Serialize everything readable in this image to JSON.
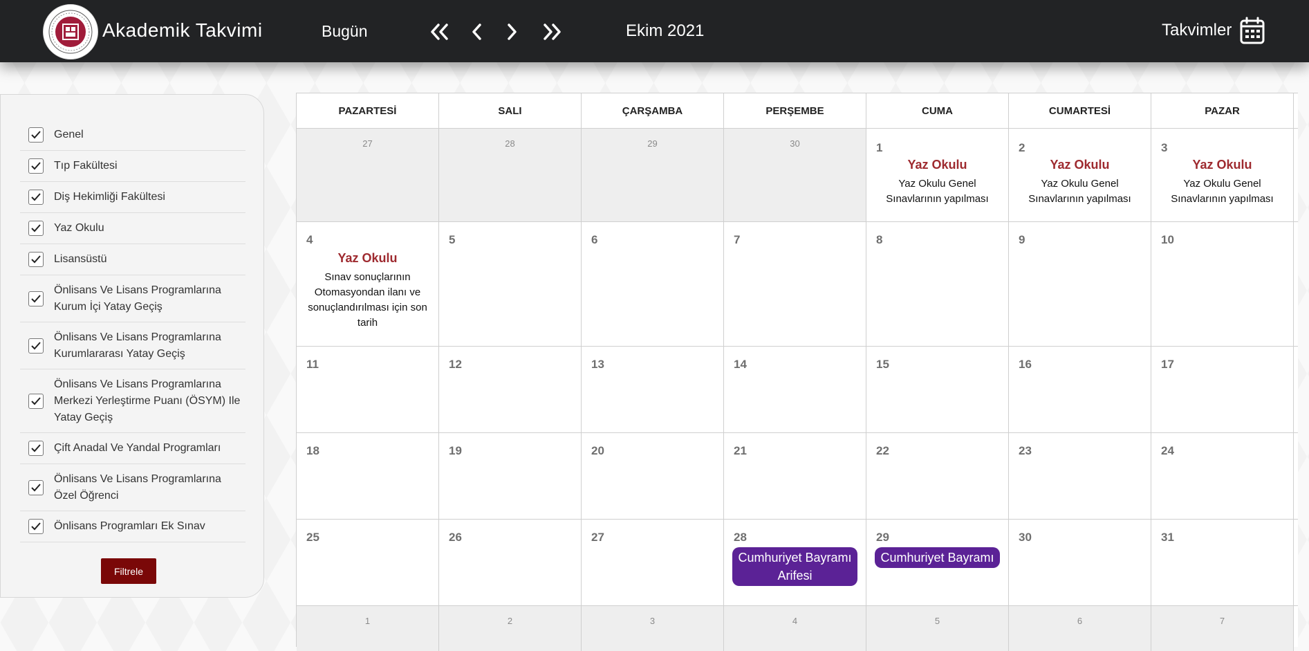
{
  "header": {
    "title": "Akademik Takvimi",
    "today_label": "Bugün",
    "month_label": "Ekim 2021",
    "calendars_label": "Takvimler"
  },
  "filters": {
    "items": [
      {
        "label": "Genel",
        "checked": true
      },
      {
        "label": "Tıp Fakültesi",
        "checked": true
      },
      {
        "label": "Diş Hekimliği Fakültesi",
        "checked": true
      },
      {
        "label": "Yaz Okulu",
        "checked": true
      },
      {
        "label": "Lisansüstü",
        "checked": true
      },
      {
        "label": "Önlisans Ve Lisans Programlarına Kurum İçi Yatay Geçiş",
        "checked": true
      },
      {
        "label": "Önlisans Ve Lisans Programlarına Kurumlararası Yatay Geçiş",
        "checked": true
      },
      {
        "label": "Önlisans Ve Lisans Programlarına Merkezi Yerleştirme Puanı (ÖSYM) Ile Yatay Geçiş",
        "checked": true
      },
      {
        "label": "Çift Anadal Ve Yandal Programları",
        "checked": true
      },
      {
        "label": "Önlisans Ve Lisans Programlarına Özel Öğrenci",
        "checked": true
      },
      {
        "label": "Önlisans Programları Ek Sınav",
        "checked": true
      }
    ],
    "button_label": "Filtrele"
  },
  "calendar": {
    "days": [
      "PAZARTESİ",
      "SALI",
      "ÇARŞAMBA",
      "PERŞEMBE",
      "CUMA",
      "CUMARTESİ",
      "PAZAR"
    ],
    "weeks": [
      [
        {
          "n": "27",
          "out": true
        },
        {
          "n": "28",
          "out": true
        },
        {
          "n": "29",
          "out": true
        },
        {
          "n": "30",
          "out": true
        },
        {
          "n": "1",
          "event": {
            "title": "Yaz Okulu",
            "desc": "Yaz Okulu Genel Sınavlarının yapılması"
          }
        },
        {
          "n": "2",
          "event": {
            "title": "Yaz Okulu",
            "desc": "Yaz Okulu Genel Sınavlarının yapılması"
          }
        },
        {
          "n": "3",
          "event": {
            "title": "Yaz Okulu",
            "desc": "Yaz Okulu Genel Sınavlarının yapılması"
          }
        }
      ],
      [
        {
          "n": "4",
          "event": {
            "title": "Yaz Okulu",
            "desc": "Sınav sonuçlarının Otomasyondan ilanı ve sonuçlandırılması için son tarih"
          }
        },
        {
          "n": "5"
        },
        {
          "n": "6"
        },
        {
          "n": "7"
        },
        {
          "n": "8"
        },
        {
          "n": "9"
        },
        {
          "n": "10"
        }
      ],
      [
        {
          "n": "11"
        },
        {
          "n": "12"
        },
        {
          "n": "13"
        },
        {
          "n": "14"
        },
        {
          "n": "15"
        },
        {
          "n": "16"
        },
        {
          "n": "17"
        }
      ],
      [
        {
          "n": "18"
        },
        {
          "n": "19"
        },
        {
          "n": "20"
        },
        {
          "n": "21"
        },
        {
          "n": "22"
        },
        {
          "n": "23"
        },
        {
          "n": "24"
        }
      ],
      [
        {
          "n": "25"
        },
        {
          "n": "26"
        },
        {
          "n": "27"
        },
        {
          "n": "28",
          "holiday": "Cumhuriyet Bayramı Arifesi"
        },
        {
          "n": "29",
          "holiday": "Cumhuriyet Bayramı"
        },
        {
          "n": "30"
        },
        {
          "n": "31"
        }
      ],
      [
        {
          "n": "1",
          "out": true
        },
        {
          "n": "2",
          "out": true
        },
        {
          "n": "3",
          "out": true
        },
        {
          "n": "4",
          "out": true
        },
        {
          "n": "5",
          "out": true
        },
        {
          "n": "6",
          "out": true
        },
        {
          "n": "7",
          "out": true
        }
      ]
    ]
  },
  "colors": {
    "topbar": "#222325",
    "event_title": "#9e2a2f",
    "holiday": "#5b2296",
    "filter_button": "#7a0808"
  }
}
